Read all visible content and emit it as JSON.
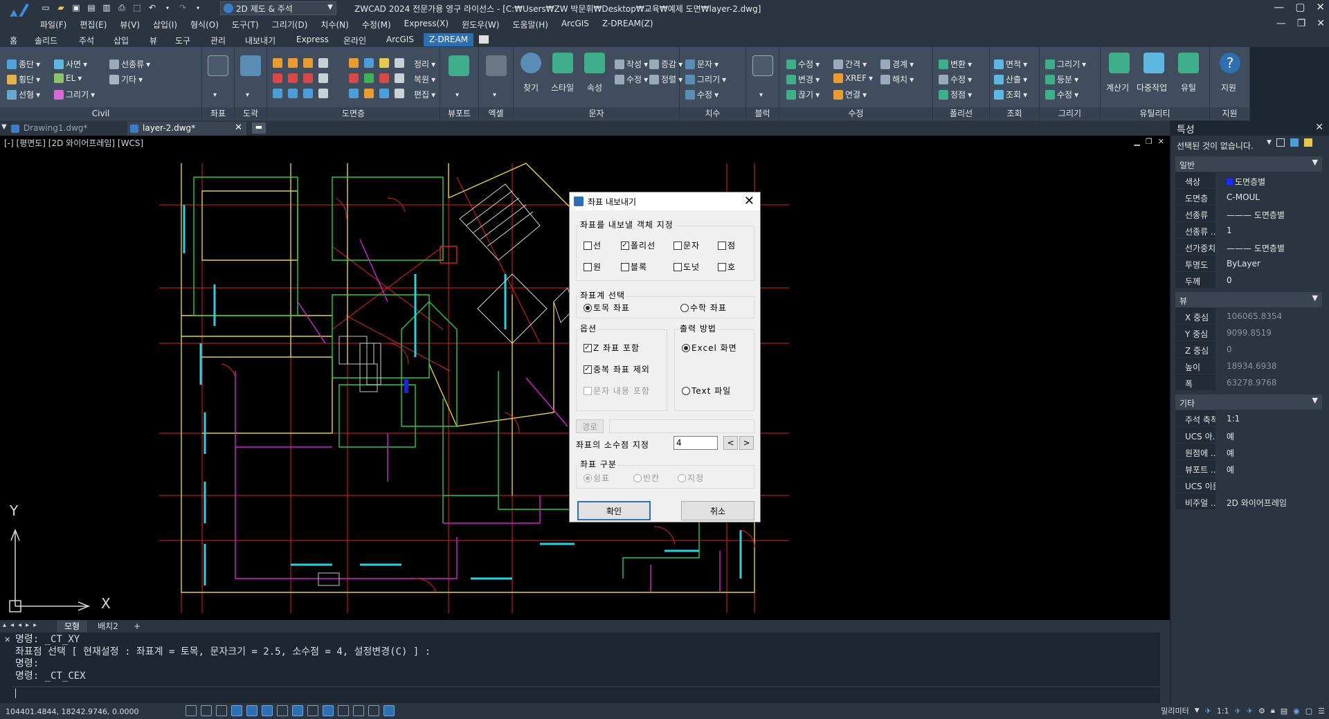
{
  "app": {
    "workspace": "2D 제도 & 주석",
    "title": "ZWCAD 2024 전문가용 영구 라이선스 - [C:₩Users₩ZW 박문휘₩Desktop₩교육₩예제 도면₩layer-2.dwg]"
  },
  "menu": [
    "파일(F)",
    "편집(E)",
    "뷰(V)",
    "삽입(I)",
    "형식(O)",
    "도구(T)",
    "그리기(D)",
    "치수(N)",
    "수정(M)",
    "Express(X)",
    "윈도우(W)",
    "도움말(H)",
    "ArcGIS",
    "Z-DREAM(Z)"
  ],
  "ribbon_tabs": [
    "홈",
    "솔리드",
    "주석",
    "삽입",
    "뷰",
    "도구",
    "관리",
    "내보내기",
    "Express",
    "온라인",
    "ArcGIS",
    "Z-DREAM"
  ],
  "ribbon": {
    "civil": {
      "title": "Civil",
      "items": [
        "종단",
        "사면",
        "선종류",
        "횡단",
        "EL",
        "기타",
        "선형",
        "그리기"
      ]
    },
    "coord": {
      "title": "좌표"
    },
    "dohak": {
      "title": "도곽"
    },
    "drawing_layer": {
      "title": "도면층",
      "items": [
        "정리",
        "복원",
        "편집"
      ]
    },
    "viewport": {
      "title": "뷰포트"
    },
    "excel": {
      "title": "엑셀"
    },
    "text": {
      "title": "문자",
      "items": [
        "찾기",
        "스타일",
        "속성",
        "작성",
        "수정",
        "증감",
        "정렬"
      ]
    },
    "dim": {
      "title": "치수",
      "items": [
        "문자",
        "그리기",
        "수정"
      ]
    },
    "block": {
      "title": "블럭"
    },
    "modify": {
      "title": "수정",
      "items": [
        "수정",
        "간격",
        "경계",
        "변경",
        "XREF",
        "해치",
        "끊기",
        "연결"
      ]
    },
    "polyline": {
      "title": "폴리선",
      "items": [
        "변환",
        "수정",
        "정점"
      ]
    },
    "query": {
      "title": "조회",
      "items": [
        "면적",
        "산출",
        "조회"
      ]
    },
    "draw": {
      "title": "그리기",
      "items": [
        "그리기",
        "등분",
        "수정"
      ]
    },
    "utility": {
      "title": "유틸리티",
      "items": [
        "계산기",
        "다중작업",
        "유틸"
      ]
    },
    "support": {
      "title": "지원",
      "items": [
        "지원"
      ]
    }
  },
  "doc_tabs": [
    "Drawing1.dwg*",
    "layer-2.dwg*"
  ],
  "viewport_label": "[-] [평면도] [2D 와이어프레임] [WCS]",
  "ucs": {
    "y": "Y",
    "x": "X"
  },
  "layout_tabs": [
    "모형",
    "배치2",
    "+"
  ],
  "command_lines": [
    "명령: _CT_XY",
    "좌표점 선택 [ 현재설정 : 좌표계 = 토목, 문자크기 = 2.5, 소수점 = 4, 설정변경(C) ] :",
    "명령:",
    "명령: _CT_CEX"
  ],
  "status": {
    "coords": "104401.4844, 18242.9746, 0.0000",
    "units": "밀리미터",
    "scale": "1:1"
  },
  "properties": {
    "title": "특성",
    "selection": "선택된 것이 없습니다.",
    "sections": {
      "general": {
        "title": "일반",
        "rows": [
          {
            "k": "색상",
            "v": "도면층별"
          },
          {
            "k": "도면층",
            "v": "C-MOUL"
          },
          {
            "k": "선종류",
            "v": "——— 도면층별"
          },
          {
            "k": "선종류 ...",
            "v": "1"
          },
          {
            "k": "선가중치",
            "v": "——— 도면층별"
          },
          {
            "k": "투명도",
            "v": "ByLayer"
          },
          {
            "k": "두께",
            "v": "0"
          }
        ]
      },
      "view": {
        "title": "뷰",
        "rows": [
          {
            "k": "X 중심",
            "v": "106065.8354"
          },
          {
            "k": "Y 중심",
            "v": "9099.8519"
          },
          {
            "k": "Z 중심",
            "v": "0"
          },
          {
            "k": "높이",
            "v": "18934.6938"
          },
          {
            "k": "폭",
            "v": "63278.9768"
          }
        ]
      },
      "misc": {
        "title": "기타",
        "rows": [
          {
            "k": "주석 축척",
            "v": "1:1"
          },
          {
            "k": "UCS 아...",
            "v": "예"
          },
          {
            "k": "원점에 ...",
            "v": "예"
          },
          {
            "k": "뷰포트 ...",
            "v": "예"
          },
          {
            "k": "UCS 이름",
            "v": ""
          },
          {
            "k": "비주얼 ...",
            "v": "2D 와이어프레임"
          }
        ]
      }
    }
  },
  "dialog": {
    "title": "좌표 내보내기",
    "group_objects": "좌표를 내보낼 객체 지정",
    "objects": [
      {
        "label": "선",
        "checked": false
      },
      {
        "label": "폴리선",
        "checked": true
      },
      {
        "label": "문자",
        "checked": false
      },
      {
        "label": "점",
        "checked": false
      },
      {
        "label": "원",
        "checked": false
      },
      {
        "label": "블록",
        "checked": false
      },
      {
        "label": "도넛",
        "checked": false
      },
      {
        "label": "호",
        "checked": false
      }
    ],
    "group_coord": "좌표계 선택",
    "coord_options": [
      "토목 좌표",
      "수학 좌표"
    ],
    "group_options": "옵션",
    "options": [
      "Z 좌표 포함",
      "중복 좌표 제외",
      "문자 내용 포함"
    ],
    "group_output": "출력 방법",
    "output": [
      "Excel 화면",
      "Text 파일"
    ],
    "path_button": "경로",
    "decimal_label": "좌표의 소수점 지정",
    "decimal_value": "4",
    "prev": "<",
    "next": ">",
    "group_sep": "좌표 구분",
    "sep": [
      "쉼표",
      "빈칸",
      "지정"
    ],
    "ok": "확인",
    "cancel": "취소"
  }
}
